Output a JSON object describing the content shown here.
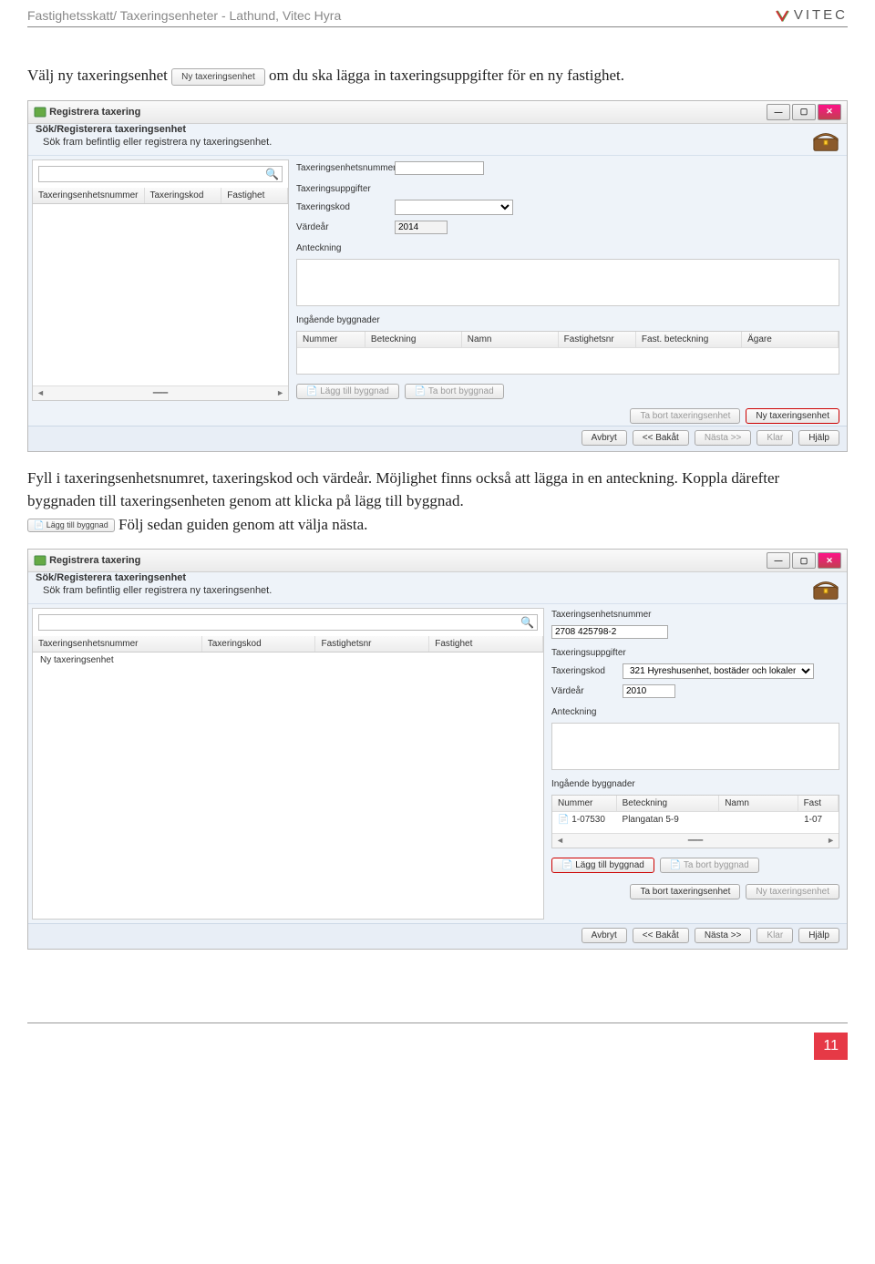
{
  "doc": {
    "header_title": "Fastighetsskatt/ Taxeringsenheter - Lathund, Vitec Hyra",
    "brand": "VITEC",
    "page_number": "11"
  },
  "para1": {
    "pre": "Välj ny taxeringsenhet ",
    "inline_btn": "Ny taxeringsenhet",
    "post": " om du ska lägga in taxeringsuppgifter för en ny fastighet."
  },
  "para2": "Fyll i taxeringsenhetsnumret, taxeringskod och värdeår. Möjlighet finns också att lägga in en anteckning. Koppla därefter byggnaden till taxeringsenheten genom att klicka på lägg till byggnad. ",
  "para2_inline_btn": "Lägg till byggnad",
  "para2_tail": " Följ sedan guiden genom att välja nästa.",
  "win_common": {
    "title": "Registrera taxering",
    "sub_bold": "Sök/Registerera taxeringsenhet",
    "sub_desc": "Sök fram befintlig eller registrera ny taxeringsenhet.",
    "left_cols": {
      "num": "Taxeringsenhetsnummer",
      "kod": "Taxeringskod",
      "fast": "Fastighet",
      "fastnr": "Fastighetsnr"
    },
    "labels": {
      "enhnr": "Taxeringsenhetsnummer",
      "uppg": "Taxeringsuppgifter",
      "kod": "Taxeringskod",
      "vardear": "Värdeår",
      "anteckning": "Anteckning",
      "ing": "Ingående byggnader"
    },
    "grid_cols": {
      "nummer": "Nummer",
      "beteckning": "Beteckning",
      "namn": "Namn",
      "fastnr": "Fastighetsnr",
      "fastbet": "Fast. beteckning",
      "agare": "Ägare",
      "fast": "Fast"
    },
    "buttons": {
      "laggbygg": "Lägg till byggnad",
      "tabortbygg": "Ta bort byggnad",
      "tabortenh": "Ta bort taxeringsenhet",
      "nyenh": "Ny taxeringsenhet",
      "avbryt": "Avbryt",
      "bakat": "<< Bakåt",
      "nasta": "Nästa >>",
      "klar": "Klar",
      "hjalp": "Hjälp"
    }
  },
  "win1": {
    "vardear_value": "2014"
  },
  "win2": {
    "left_row1": "Ny taxeringsenhet",
    "enhnr_value": "2708 425798-2",
    "kod_value": "321 Hyreshusenhet, bostäder och lokaler",
    "vardear_value": "2010",
    "grid_row": {
      "nummer": "1-07530",
      "beteckning": "Plangatan 5-9",
      "namn": "",
      "fast": "1-07"
    }
  }
}
